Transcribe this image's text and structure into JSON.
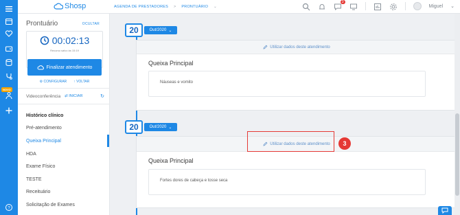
{
  "brand": {
    "name": "Shosp"
  },
  "breadcrumb": [
    {
      "label": "AGENDA DE PRESTADORES"
    },
    {
      "label": "PRONTUÁRIO"
    }
  ],
  "user": {
    "name": "Miguel"
  },
  "notifications": {
    "chat_count": "3"
  },
  "sidebar_rail": {
    "novo_badge": "NOVO"
  },
  "panel": {
    "title": "Prontuário",
    "hide_label": "OCULTAR",
    "timer": "00:02:13",
    "timer_caption": "Recurso salvo às 15:19",
    "finish_button": "Finalizar atendimento",
    "configure_link": "CONFIGURAR",
    "back_link": "VOLTAR",
    "video_label": "Videoconferência",
    "video_start": "INICIAR",
    "menu_header": "Histórico clínico",
    "menu_items": [
      "Pré-atendimento",
      "Queixa Principal",
      "HDA",
      "Exame Físico",
      "TESTE",
      "Receituário",
      "Solicitação de Exames"
    ]
  },
  "entries": [
    {
      "day": "20",
      "month": "Out/2020",
      "use_data": "Utilizar dados deste atendimento",
      "section_title": "Queixa Principal",
      "content": "Náuseas e vomito"
    },
    {
      "day": "20",
      "month": "Out/2020",
      "use_data": "Utilizar dados deste atendimento",
      "section_title": "Queixa Principal",
      "content": "Fortes dores de cabeça e tosse seca"
    }
  ],
  "annotation": {
    "step": "3",
    "color": "#e53935"
  },
  "colors": {
    "primary": "#1e88e5",
    "rail": "#1e88e5"
  }
}
